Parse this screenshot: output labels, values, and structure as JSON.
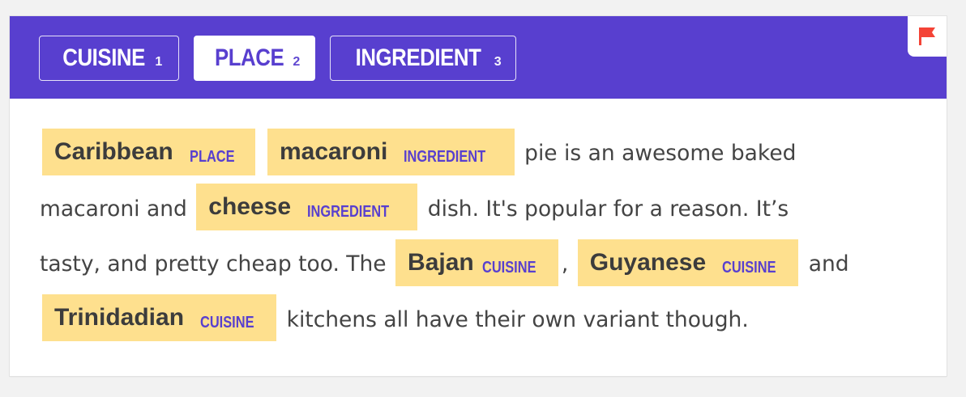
{
  "labels": [
    {
      "name": "CUISINE",
      "key": "1",
      "selected": false
    },
    {
      "name": "PLACE",
      "key": "2",
      "selected": true
    },
    {
      "name": "INGREDIENT",
      "key": "3",
      "selected": false
    }
  ],
  "flag": {
    "icon": "flag-icon",
    "color": "#f44336"
  },
  "colors": {
    "bar": "#583fcf",
    "highlight": "#fee08e",
    "entity_label": "#583fcf",
    "text": "#444444"
  },
  "text": {
    "line1": {
      "ent1": {
        "text": "Caribbean",
        "label": "PLACE"
      },
      "ent2": {
        "text": "macaroni",
        "label": "INGREDIENT"
      },
      "after": "pie is an awesome baked"
    },
    "line2": {
      "before": "macaroni and",
      "ent1": {
        "text": "cheese",
        "label": "INGREDIENT"
      },
      "after": "dish. It's popular for a reason. It’s"
    },
    "line3": {
      "before": "tasty, and pretty cheap too. The",
      "ent1": {
        "text": "Bajan",
        "label": "CUISINE"
      },
      "mid": ",",
      "ent2": {
        "text": "Guyanese",
        "label": "CUISINE"
      },
      "after": "and"
    },
    "line4": {
      "ent1": {
        "text": "Trinidadian",
        "label": "CUISINE"
      },
      "after": "kitchens all have their own variant though."
    }
  }
}
